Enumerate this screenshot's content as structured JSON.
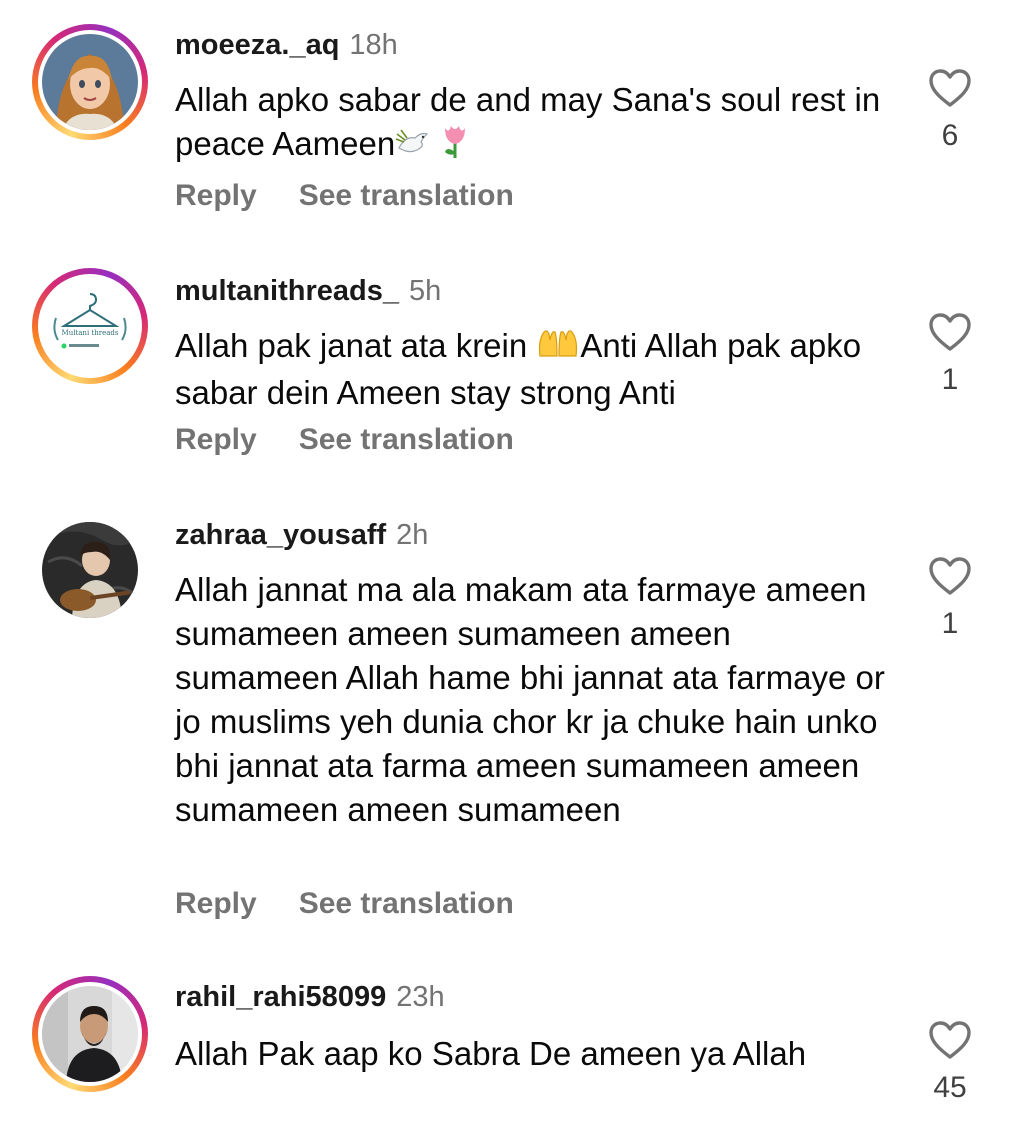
{
  "colors": {
    "text_primary": "#0a0a0a",
    "text_secondary": "#737373",
    "story_ring": [
      "#feda75",
      "#fa7e1e",
      "#d62976",
      "#962fbf"
    ]
  },
  "icons": {
    "like": "heart-outline-icon",
    "dove": "dove-emoji",
    "tulip": "tulip-emoji",
    "palms": "palms-up-emoji"
  },
  "actions": {
    "reply_label": "Reply",
    "translate_label": "See translation"
  },
  "comments": [
    {
      "username": "moeeza._aq",
      "time": "18h",
      "text": "Allah apko sabar de and may Sana's soul rest in peace Aameen",
      "likes": "6",
      "story_ring": true
    },
    {
      "username": "multanithreads_",
      "time": "5h",
      "text_before_emoji": "Allah pak janat ata krein ",
      "text_after_emoji": "Anti Allah pak apko sabar dein Ameen stay strong Anti",
      "avatar_text": "Multani threads",
      "likes": "1",
      "story_ring": true
    },
    {
      "username": "zahraa_yousaff",
      "time": "2h",
      "text": "Allah jannat ma ala makam ata farmaye ameen sumameen ameen sumameen ameen sumameen Allah hame bhi jannat ata farmaye or jo muslims yeh dunia chor kr ja chuke hain unko bhi jannat ata farma ameen sumameen ameen sumameen ameen sumameen",
      "likes": "1",
      "story_ring": false
    },
    {
      "username": "rahil_rahi58099",
      "time": "23h",
      "text": "Allah Pak aap ko Sabra De ameen ya Allah",
      "likes": "45",
      "story_ring": true
    }
  ]
}
